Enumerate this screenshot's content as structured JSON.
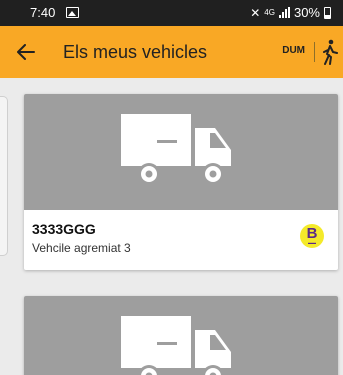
{
  "status_bar": {
    "time": "7:40",
    "network": "4G",
    "battery": "30%",
    "icons": [
      "image-icon",
      "mute-icon",
      "network-icon",
      "signal-icon",
      "battery-icon"
    ]
  },
  "app_bar": {
    "title": "Els meus vehicles",
    "dum_label": "DUM",
    "back_icon": "arrow-left-icon",
    "action_icon": "walker-icon",
    "color": "#f9a825"
  },
  "vehicles": [
    {
      "plate": "3333GGG",
      "description": "Vehcile agremiat 3",
      "image_icon": "truck-icon",
      "badge": {
        "letter": "B"
      }
    },
    {
      "image_icon": "truck-icon"
    }
  ],
  "colors": {
    "accent": "#f9a825",
    "card_image_bg": "#9e9e9e",
    "badge_bg": "#f4ea2a",
    "badge_text": "#5b2a86"
  }
}
